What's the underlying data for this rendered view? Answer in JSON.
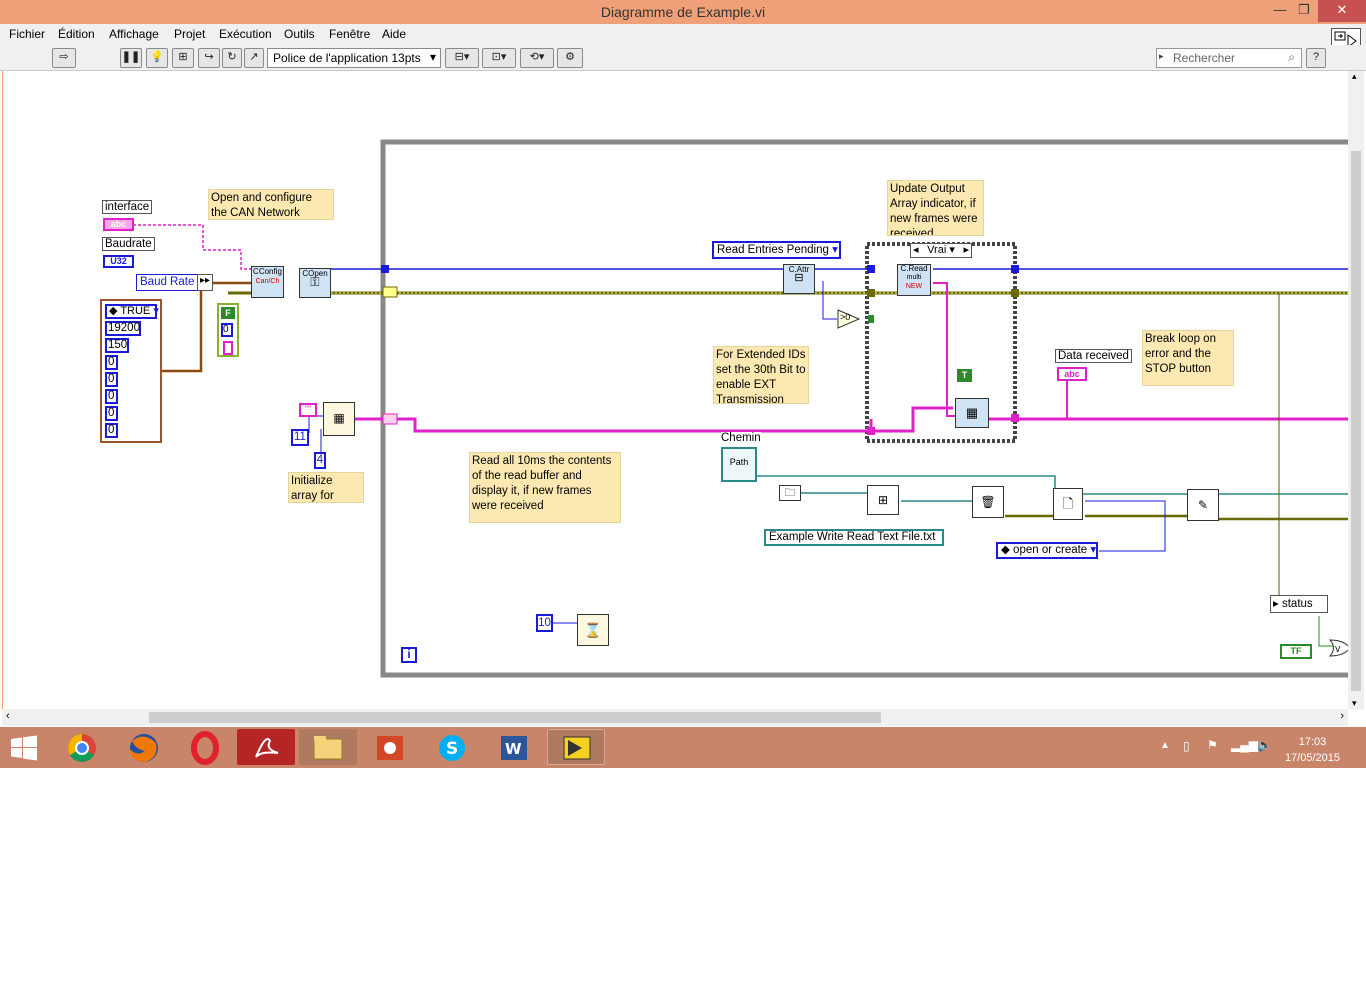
{
  "window": {
    "title": "Diagramme de Example.vi",
    "buttons": [
      "—",
      "❐",
      "✕"
    ]
  },
  "menu": [
    "Fichier",
    "Édition",
    "Affichage",
    "Projet",
    "Exécution",
    "Outils",
    "Fenêtre",
    "Aide"
  ],
  "toolbar": {
    "font": "Police de l'application 13pts",
    "search_placeholder": "Rechercher",
    "help": "?"
  },
  "diagram": {
    "interface_label": "interface",
    "interface_const": "abc",
    "baudrate_label": "Baudrate",
    "baudrate_const": "U32",
    "baud_rate_node": "Baud Rate",
    "cluster_values": [
      "TRUE",
      "19200",
      "150",
      "0",
      "0",
      "0",
      "0",
      "0"
    ],
    "f_const": "F",
    "f_value": "0",
    "config_vi": "CConfig",
    "config_vi_sub": "Can/Ch",
    "open_vi": "COpen",
    "note_open": "Open and configure the CAN Network",
    "string_const": "\"\"",
    "num_11": "11",
    "num_4": "4",
    "note_init": "Initialize array for output",
    "read_entries": "Read Entries Pending",
    "attr_vi": "C.Attr",
    "cmp_vi": ">0",
    "note_update": "Update Output Array indicator, if new frames were received",
    "case_selector": "Vrai",
    "read_vi": "C.Read",
    "read_vi_sub": "multi",
    "read_vi_new": "NEW",
    "t_const": "T",
    "note_ext": "For Extended IDs set the 30th Bit to enable EXT Transmission",
    "data_received_label": "Data received",
    "data_received_const": "abc",
    "note_break": "Break loop on error and the STOP button",
    "chemin_label": "Chemin",
    "path_control": "Path",
    "note_read": "Read all 10ms the contents of the read buffer and display it, if new frames were received",
    "file_name": "Example Write Read Text File.txt",
    "open_mode": "open or create",
    "wait_value": "10",
    "loop_iter": "i",
    "status_label": "status",
    "tf_const": "TF"
  },
  "taskbar": {
    "time": "17:03",
    "date": "17/05/2015"
  },
  "colors": {
    "title": "#f0a078",
    "taskbar": "#c8856a",
    "note": "#fce9b2",
    "wire_blue": "#1a1ad8",
    "wire_pink": "#e020c8",
    "wire_olive": "#7a7a00",
    "wire_brown": "#8b4a10",
    "wire_teal": "#2a8a8a"
  }
}
